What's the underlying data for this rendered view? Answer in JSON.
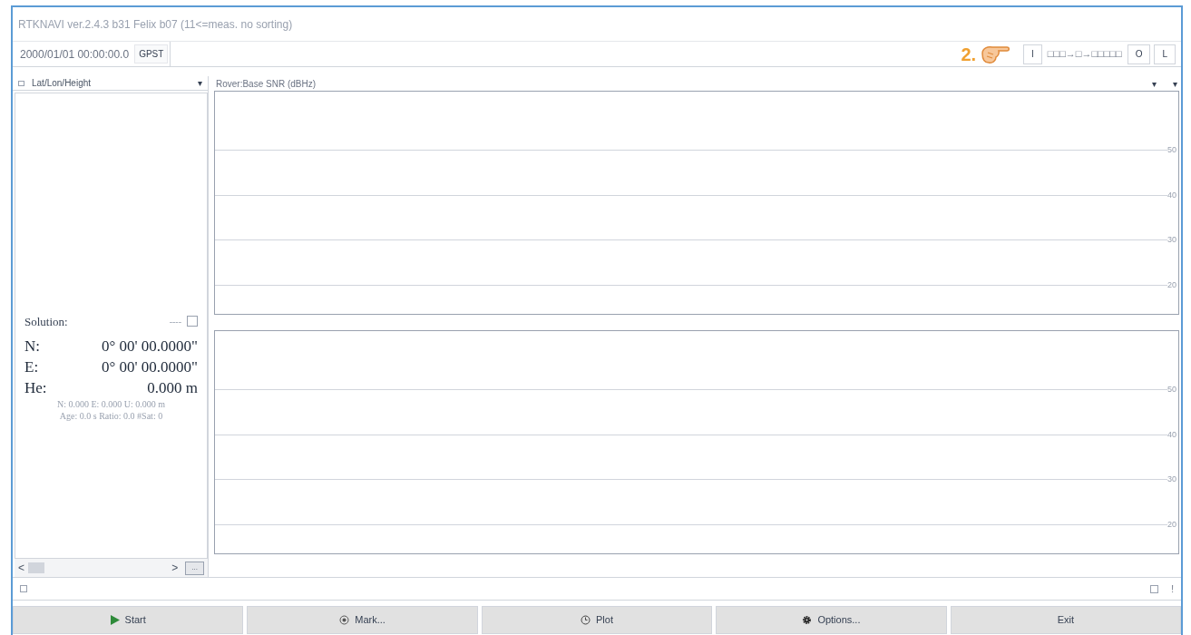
{
  "window": {
    "title": "RTKNAVI ver.2.4.3 b31 Felix b07 (11<=meas. no sorting)"
  },
  "time_bar": {
    "time": "2000/01/01 00:00:00.0",
    "time_system_button": "GPST",
    "annotation": "2.",
    "buttons": [
      {
        "kind": "button",
        "label": "I"
      },
      {
        "kind": "text",
        "label": "□□□→□→□□□□□"
      },
      {
        "kind": "button",
        "label": "O"
      },
      {
        "kind": "button",
        "label": "L"
      }
    ]
  },
  "solution_panel": {
    "header": "Lat/Lon/Height",
    "header_caret": "▾",
    "solution_label": "Solution:",
    "solution_status": "----",
    "checked": false,
    "rows": [
      {
        "label": "N:",
        "value": "0° 00' 00.0000\""
      },
      {
        "label": "E:",
        "value": "0° 00' 00.0000\""
      },
      {
        "label": "He:",
        "value": "0.000 m"
      }
    ],
    "details": [
      "N: 0.000 E: 0.000 U: 0.000 m",
      "Age: 0.0 s Ratio: 0.0 #Sat: 0"
    ],
    "scroll_left": "<",
    "scroll_right": ">",
    "more_button": "..."
  },
  "snr_panel": {
    "header": "Rover:Base SNR (dBHz)",
    "carets": [
      "▾",
      "▾"
    ],
    "charts": [
      {
        "y_ticks": [
          "50",
          "40",
          "30",
          "20"
        ]
      },
      {
        "y_ticks": [
          "50",
          "40",
          "30",
          "20"
        ]
      }
    ]
  },
  "status_bar": {
    "checked": false,
    "info": "!"
  },
  "buttons": [
    {
      "kind": "start",
      "label": "Start"
    },
    {
      "kind": "mark",
      "label": "Mark..."
    },
    {
      "kind": "plot",
      "label": "Plot"
    },
    {
      "kind": "options",
      "label": "Options..."
    },
    {
      "kind": "exit",
      "label": "Exit"
    }
  ]
}
